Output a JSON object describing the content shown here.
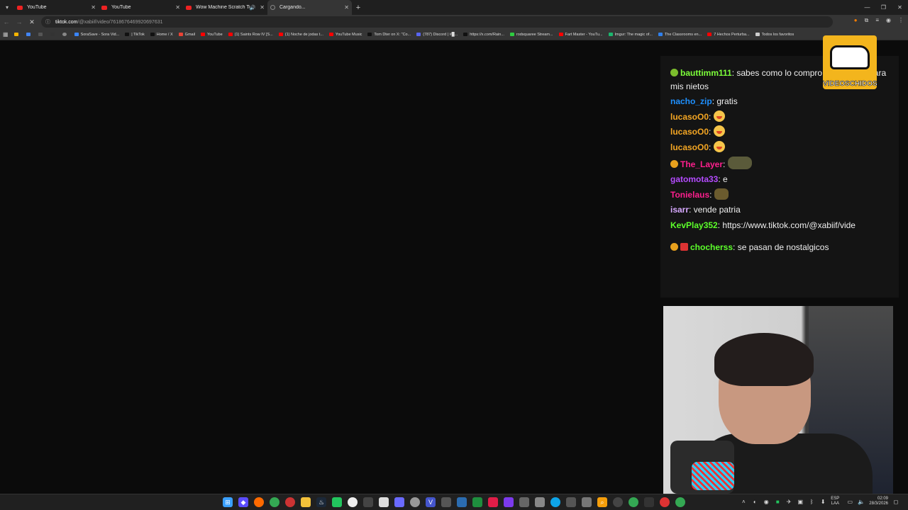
{
  "browser": {
    "tabs": [
      {
        "title": "YouTube",
        "icon": "youtube-icon",
        "state": "normal"
      },
      {
        "title": "YouTube",
        "icon": "youtube-icon",
        "state": "normal"
      },
      {
        "title": "Wow Machine Scratch Test",
        "icon": "youtube-icon",
        "state": "audio"
      },
      {
        "title": "Cargando...",
        "icon": "loading-icon",
        "state": "active"
      }
    ],
    "new_tab": "+",
    "url_host": "tiktok.com",
    "url_path": "/@xabiif/video/7618676469920697631"
  },
  "bookmarks": [
    {
      "label": "SoraSave - Sora Vid...",
      "color": "#3a86ff"
    },
    {
      "label": "| TikTok",
      "color": "#111111"
    },
    {
      "label": "Home / X",
      "color": "#111111"
    },
    {
      "label": "Gmail",
      "color": "#ea4335"
    },
    {
      "label": "YouTube",
      "color": "#ff0000"
    },
    {
      "label": "(1) Saints Row IV [S...",
      "color": "#ff0000"
    },
    {
      "label": "(1) Noche de jodas t...",
      "color": "#ff0000"
    },
    {
      "label": "YouTube Music",
      "color": "#ff0000"
    },
    {
      "label": "Tom Dter on X: \"Co...",
      "color": "#111111"
    },
    {
      "label": "(787) Discord | #█...",
      "color": "#5865f2"
    },
    {
      "label": "https://x.com/Rain...",
      "color": "#111111"
    },
    {
      "label": "rodsquaree Stream...",
      "color": "#2ecc40"
    },
    {
      "label": "Fart Master - YouTu...",
      "color": "#ff0000"
    },
    {
      "label": "Imgur: The magic of...",
      "color": "#1bb76e"
    },
    {
      "label": "The Classrooms en...",
      "color": "#2f80ed"
    },
    {
      "label": "7 Hechos Perturba...",
      "color": "#ff0000"
    },
    {
      "label": "Todos los favoritos",
      "color": "#cccccc"
    }
  ],
  "chat": {
    "messages": [
      {
        "user": "bauttimm111",
        "color": "#7cff3a",
        "text": ": sabes como lo compro y lo guardo para mis nietos",
        "badge": "g",
        "emote": ""
      },
      {
        "user": "nacho_zip",
        "color": "#1e90ff",
        "text": ": gratis",
        "badge": "",
        "emote": ""
      },
      {
        "user": "lucasoO0",
        "color": "#f4a623",
        "text": ": ",
        "badge": "",
        "emote": "face"
      },
      {
        "user": "lucasoO0",
        "color": "#f4a623",
        "text": ": ",
        "badge": "",
        "emote": "face"
      },
      {
        "user": "lucasoO0",
        "color": "#f4a623",
        "text": ": ",
        "badge": "",
        "emote": "face"
      },
      {
        "user": "The_Layer",
        "color": "#ff1f8e",
        "text": ": ",
        "badge": "o",
        "emote": "dark"
      },
      {
        "user": "gatomota33",
        "color": "#b44bff",
        "text": ": e",
        "badge": "",
        "emote": ""
      },
      {
        "user": "Tonielaus",
        "color": "#ff1f8e",
        "text": ": ",
        "badge": "",
        "emote": "small"
      },
      {
        "user": "isarr",
        "color": "#d7a9ff",
        "text": ": vende patria",
        "badge": "",
        "emote": ""
      },
      {
        "user": "KevPlay352",
        "color": "#5cff2a",
        "text": ": https://www.tiktok.com/@xabiif/vide",
        "badge": "",
        "emote": ""
      },
      {
        "user": "chocherss",
        "color": "#5cff2a",
        "text": ": se pasan de nostalgicos",
        "badge": "or",
        "emote": ""
      }
    ]
  },
  "overlay": {
    "logo_text": "VIDEOSCHIDOS"
  },
  "taskbar": {
    "lang_top": "ESP",
    "lang_bottom": "LAA",
    "time": "02:09",
    "date": "28/3/2026"
  }
}
